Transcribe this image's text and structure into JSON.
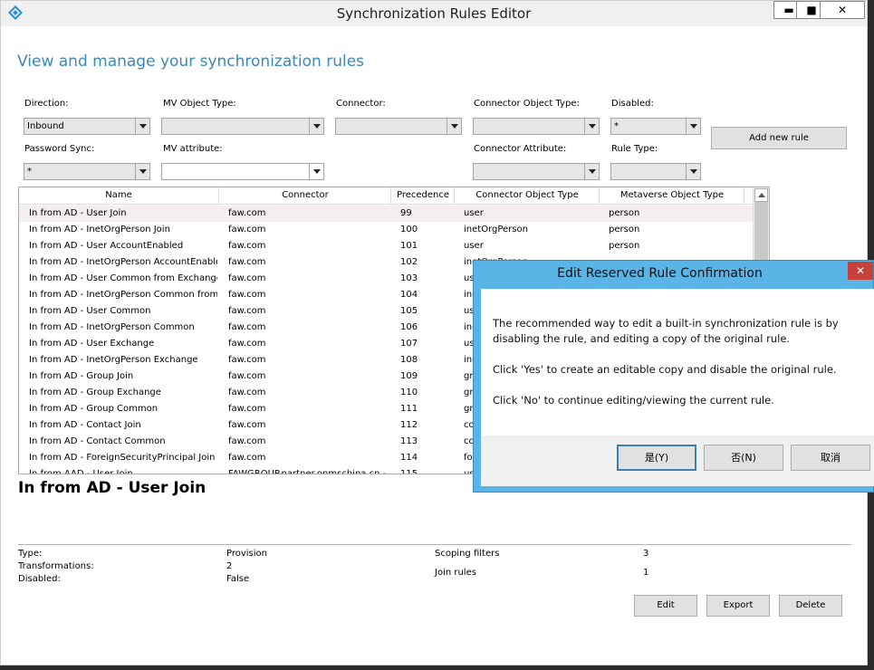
{
  "window": {
    "title": "Synchronization Rules Editor",
    "heading": "View and manage your synchronization rules",
    "controls": {
      "minimize": "▬",
      "maximize": "■",
      "close": "✕"
    }
  },
  "filters": {
    "direction": {
      "label": "Direction:",
      "value": "Inbound"
    },
    "mv_object_type": {
      "label": "MV Object Type:",
      "value": ""
    },
    "connector": {
      "label": "Connector:",
      "value": ""
    },
    "connector_object_type": {
      "label": "Connector Object Type:",
      "value": ""
    },
    "disabled": {
      "label": "Disabled:",
      "value": "*"
    },
    "password_sync": {
      "label": "Password Sync:",
      "value": "*"
    },
    "mv_attribute": {
      "label": "MV attribute:",
      "value": ""
    },
    "connector_attribute": {
      "label": "Connector Attribute:",
      "value": ""
    },
    "rule_type": {
      "label": "Rule Type:",
      "value": ""
    },
    "add_new_rule": "Add new rule"
  },
  "grid": {
    "columns": [
      "Name",
      "Connector",
      "Precedence",
      "Connector Object Type",
      "Metaverse Object Type"
    ],
    "rows": [
      [
        "In from AD - User Join",
        "faw.com",
        "99",
        "user",
        "person"
      ],
      [
        "In from AD - InetOrgPerson Join",
        "faw.com",
        "100",
        "inetOrgPerson",
        "person"
      ],
      [
        "In from AD - User AccountEnabled",
        "faw.com",
        "101",
        "user",
        "person"
      ],
      [
        "In from AD - InetOrgPerson AccountEnabled",
        "faw.com",
        "102",
        "inetOrgPerson",
        ""
      ],
      [
        "In from AD - User Common from Exchange",
        "faw.com",
        "103",
        "user",
        ""
      ],
      [
        "In from AD - InetOrgPerson Common from Exchange",
        "faw.com",
        "104",
        "inetOrgPerson",
        ""
      ],
      [
        "In from AD - User Common",
        "faw.com",
        "105",
        "user",
        ""
      ],
      [
        "In from AD - InetOrgPerson Common",
        "faw.com",
        "106",
        "inetOrgPerson",
        ""
      ],
      [
        "In from AD - User Exchange",
        "faw.com",
        "107",
        "user",
        ""
      ],
      [
        "In from AD - InetOrgPerson Exchange",
        "faw.com",
        "108",
        "inetOrgPerson",
        ""
      ],
      [
        "In from AD - Group Join",
        "faw.com",
        "109",
        "group",
        ""
      ],
      [
        "In from AD - Group Exchange",
        "faw.com",
        "110",
        "group",
        ""
      ],
      [
        "In from AD - Group Common",
        "faw.com",
        "111",
        "group",
        ""
      ],
      [
        "In from AD - Contact Join",
        "faw.com",
        "112",
        "contact",
        ""
      ],
      [
        "In from AD - Contact Common",
        "faw.com",
        "113",
        "contact",
        ""
      ],
      [
        "In from AD - ForeignSecurityPrincipal Join User",
        "faw.com",
        "114",
        "foreignSecurityPrincipal",
        ""
      ],
      [
        "In from AAD - User Join",
        "FAWGROUP.partner.onmschina.cn - AAD",
        "115",
        "user",
        ""
      ]
    ]
  },
  "details": {
    "rule_name": "In from AD - User Join",
    "type_label": "Type:",
    "type_value": "Provision",
    "transformations_label": "Transformations:",
    "transformations_value": "2",
    "disabled_label": "Disabled:",
    "disabled_value": "False",
    "scoping_label": "Scoping filters",
    "scoping_value": "3",
    "join_label": "Join rules",
    "join_value": "1",
    "edit": "Edit",
    "export": "Export",
    "delete": "Delete"
  },
  "dialog": {
    "title": "Edit Reserved Rule Confirmation",
    "close": "✕",
    "line1": "The recommended way to edit a built-in synchronization rule is by",
    "line2": "disabling the rule, and editing a copy of the original rule.",
    "line3": "Click 'Yes' to create an editable copy and disable the original rule.",
    "line4": "Click 'No' to continue editing/viewing the current rule.",
    "yes": "是(Y)",
    "no": "否(N)",
    "cancel": "取消"
  }
}
